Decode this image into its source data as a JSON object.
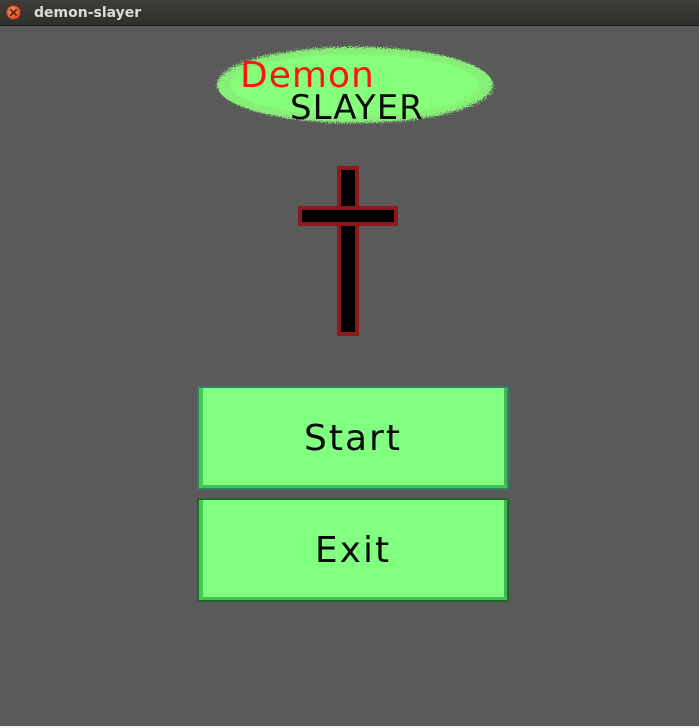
{
  "window": {
    "title": "demon-slayer"
  },
  "logo": {
    "line1": "Demon",
    "line2": "SLAYER"
  },
  "menu": {
    "start_label": "Start",
    "exit_label": "Exit"
  },
  "colors": {
    "background": "#5a5a5a",
    "button_fill": "#80ff80",
    "logo_red": "#ff1414",
    "cross_outline": "#8b1a1a"
  }
}
